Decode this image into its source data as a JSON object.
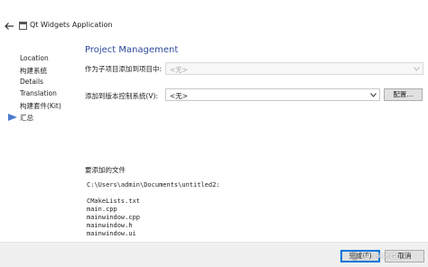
{
  "window": {
    "title": "Qt Widgets Application"
  },
  "sidebar": {
    "items": [
      {
        "label": "Location"
      },
      {
        "label": "构建系统"
      },
      {
        "label": "Details"
      },
      {
        "label": "Translation"
      },
      {
        "label": "构建套件(Kit)"
      },
      {
        "label": "汇总",
        "current": true
      }
    ]
  },
  "page": {
    "title": "Project Management",
    "subproject": {
      "label": "作为子项目添加到项目中:",
      "value": "<无>",
      "enabled": false
    },
    "version_control": {
      "label": "添加到版本控制系统(V):",
      "value": "<无>",
      "configure_label": "配置..."
    },
    "files_heading": "要添加的文件",
    "path": "C:\\Users\\admin\\Documents\\untitled2:",
    "files": [
      "CMakeLists.txt",
      "main.cpp",
      "mainwindow.cpp",
      "mainwindow.h",
      "mainwindow.ui"
    ]
  },
  "footer": {
    "finish_label": "完成(F)",
    "cancel_label": "取消"
  },
  "watermark": {
    "text": "@小天才G0"
  },
  "colors": {
    "title": "#2b4a9c",
    "current_arrow": "#4a7bd0",
    "default_button_border": "#0078d7"
  }
}
